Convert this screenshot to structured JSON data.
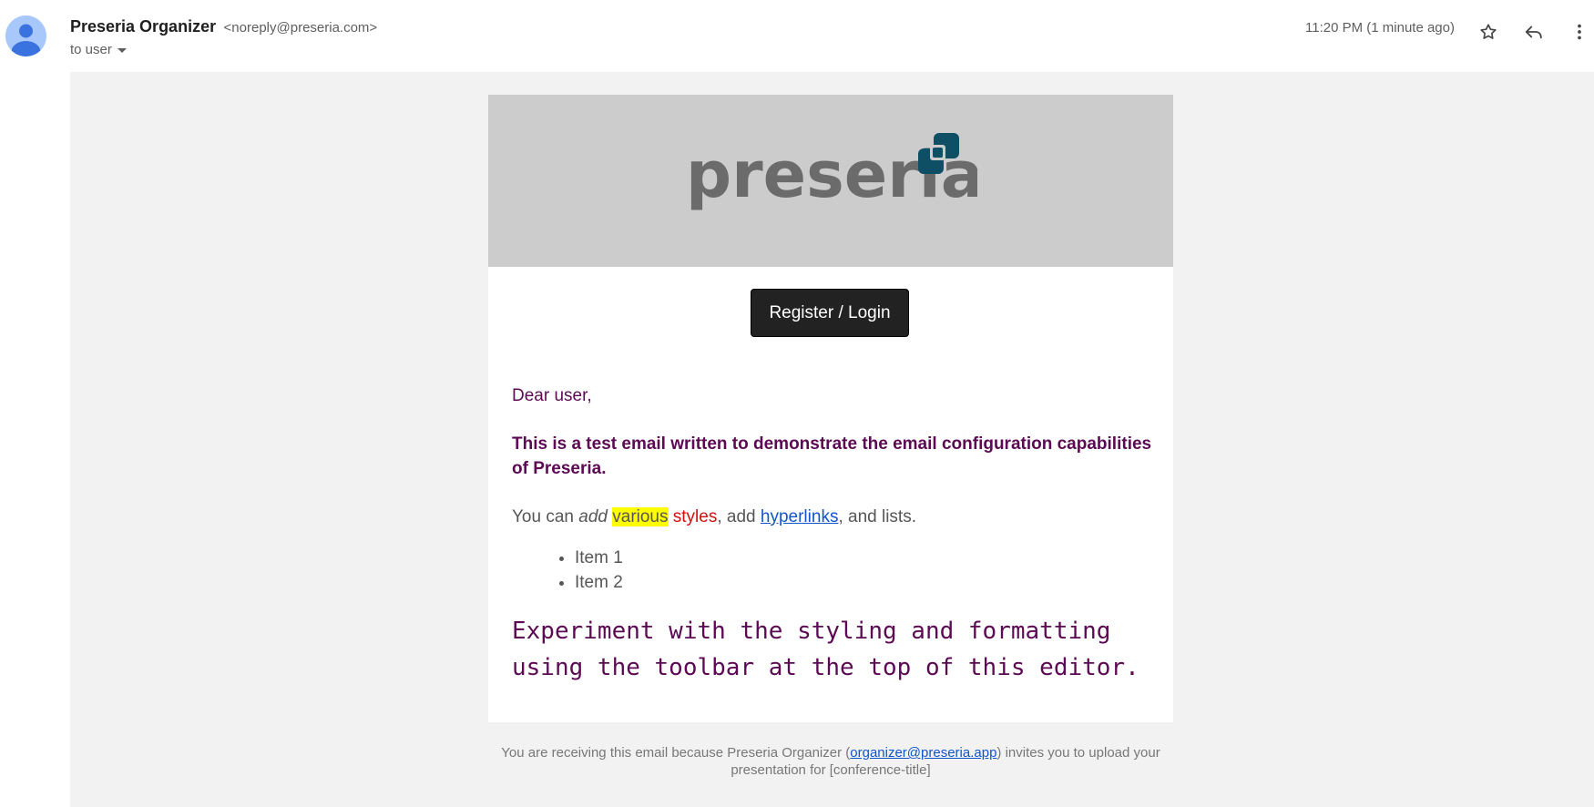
{
  "header": {
    "sender_name": "Preseria Organizer",
    "sender_email": "<noreply@preseria.com>",
    "to_label": "to user",
    "timestamp": "11:20 PM (1 minute ago)",
    "icons": {
      "star": "star-icon",
      "reply": "reply-icon",
      "more": "more-vert-icon",
      "avatar": "person-avatar-icon"
    }
  },
  "email": {
    "logo_text": "preseria",
    "button_label": "Register / Login",
    "greeting": "Dear user,",
    "bold_paragraph": "This is a test email written to demonstrate the email configuration capabilities of Preseria.",
    "styles_line": {
      "part1": "You can ",
      "italic": "add",
      "space": " ",
      "highlight": "various",
      "red": " styles",
      "part2": ", add ",
      "link": "hyperlinks",
      "part3": ", and lists."
    },
    "list_items": [
      "Item 1",
      "Item 2"
    ],
    "mono_paragraph": "Experiment with the styling and formatting using the toolbar at the top of this editor."
  },
  "footer": {
    "text_before": "You are receiving this email because Preseria Organizer (",
    "link": "organizer@preseria.app",
    "text_after": ") invites you to upload your presentation for [conference-title]"
  },
  "colors": {
    "banner": "#cccccc",
    "logo_gray": "#6b6b6b",
    "logo_teal": "#0e4f66",
    "purple_text": "#5b0a53",
    "link": "#1155cc",
    "highlight": "#ffff00",
    "red_text": "#d01010",
    "button_bg": "#222222"
  }
}
